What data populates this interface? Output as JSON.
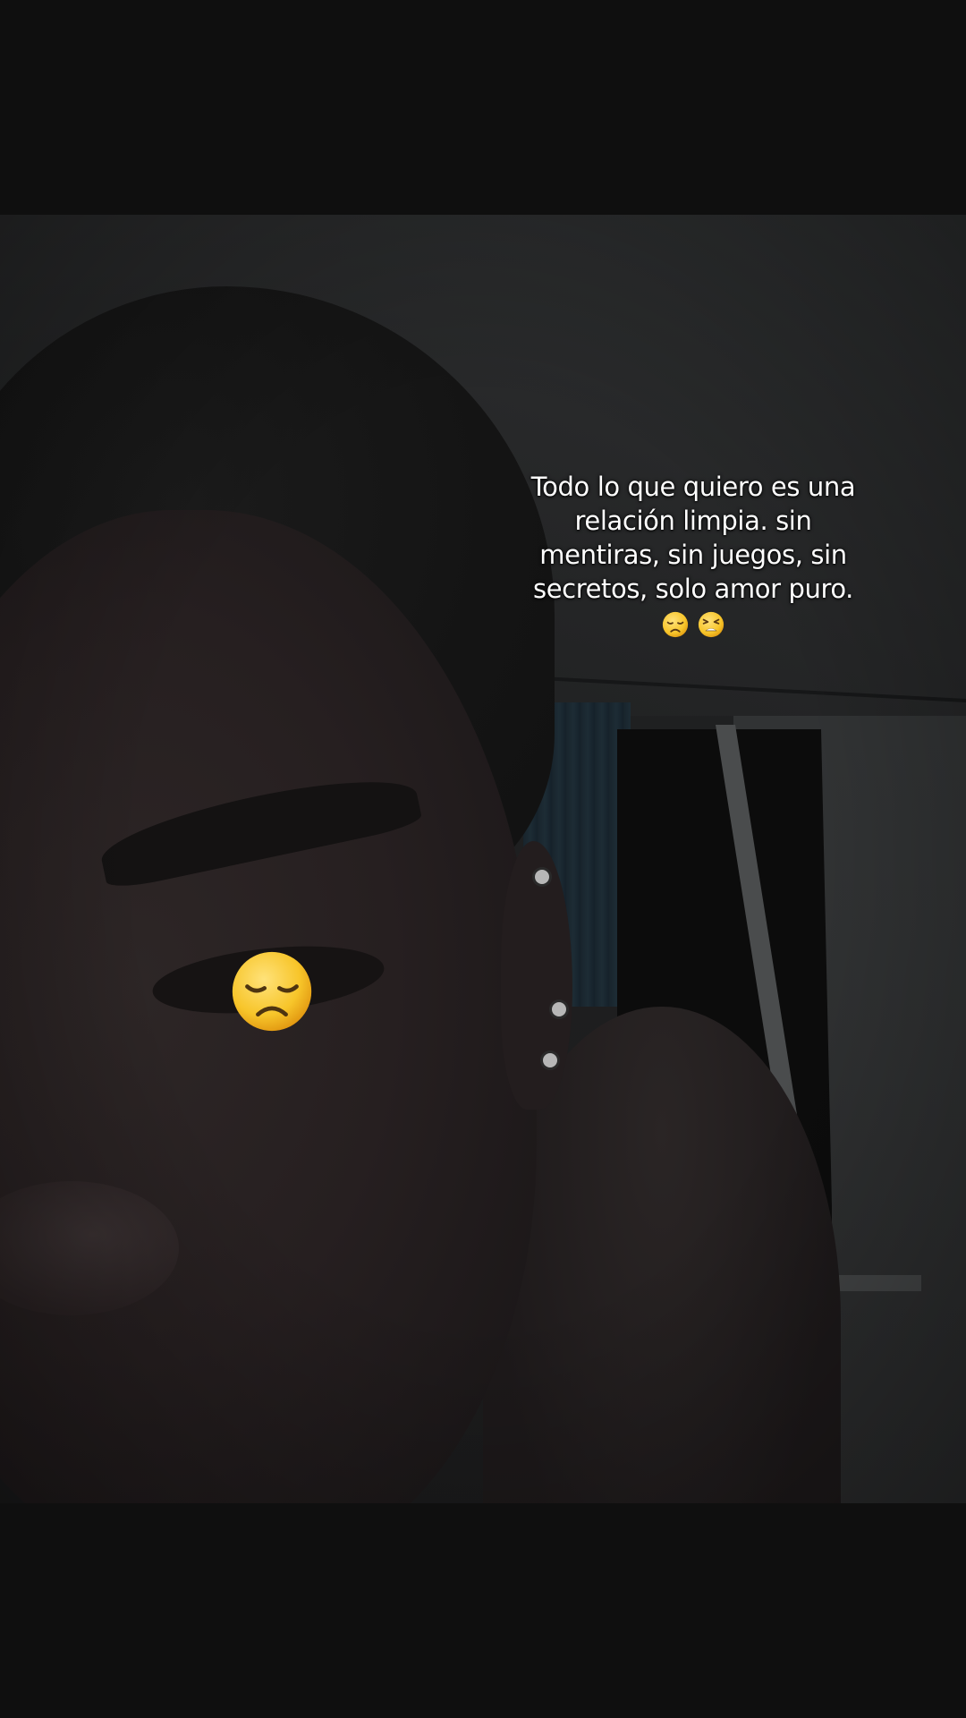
{
  "caption": {
    "line1": "Todo lo que quiero es una",
    "line2": "relación limpia. sin",
    "line3": "mentiras, sin juegos, sin",
    "line4": "secretos, solo amor puro.",
    "emojis": [
      "disappointed-face",
      "tired-face"
    ]
  },
  "overlay_emoji": "disappointed-face",
  "colors": {
    "letterbox": "#0f0f0f",
    "caption_text": "#ffffff",
    "emoji_yellow": "#f7c52a"
  }
}
